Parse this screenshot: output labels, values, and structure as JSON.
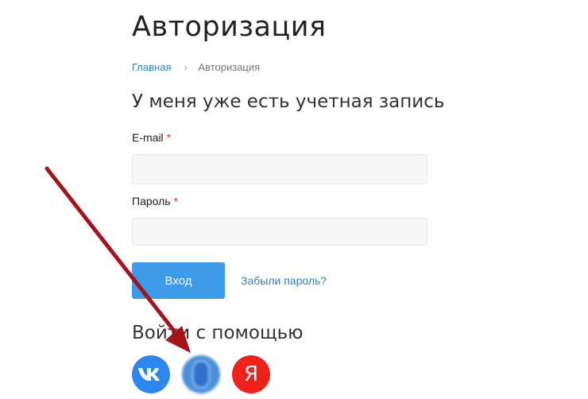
{
  "page": {
    "title": "Авторизация"
  },
  "breadcrumb": {
    "home": "Главная",
    "separator": "›",
    "current": "Авторизация"
  },
  "login_form": {
    "heading": "У меня уже есть учетная запись",
    "email_label": "E-mail",
    "email_value": "",
    "password_label": "Пароль",
    "password_value": "",
    "required_mark": "*",
    "submit_label": "Вход",
    "forgot_link": "Забыли пароль?"
  },
  "social_login": {
    "heading": "Войти с помощью",
    "providers": [
      {
        "icon": "vk-icon",
        "label": "VK"
      },
      {
        "icon": "blurred-provider-icon",
        "label": ""
      },
      {
        "icon": "yandex-icon",
        "label": "Я"
      }
    ]
  },
  "colors": {
    "accent": "#3d9bea",
    "link": "#2f85c7",
    "required": "#e03c3c",
    "vk": "#2d87f0",
    "yandex": "#f0201b",
    "annotation_arrow": "#a5141a"
  }
}
